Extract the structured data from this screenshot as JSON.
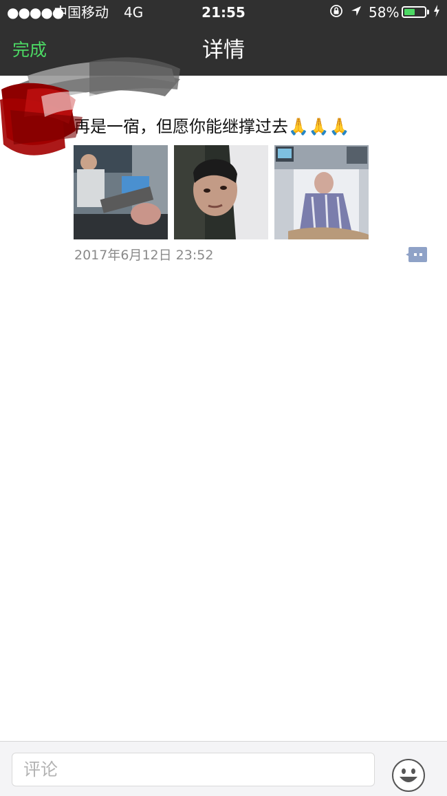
{
  "status_bar": {
    "signal": "●●●●●",
    "carrier": "中国移动",
    "network": "4G",
    "time": "21:55",
    "battery": "58%",
    "battery_level": 0.58,
    "battery_color": "#4cd964"
  },
  "nav": {
    "done_label": "完成",
    "title": "详情"
  },
  "post": {
    "text": "再是一宿，但愿你能继撑过去🙏🙏🙏",
    "photos": [
      "photo-1",
      "photo-2",
      "photo-3"
    ],
    "time": "2017年6月12日 23:52"
  },
  "comment_bar": {
    "placeholder": "评论"
  },
  "icons": {
    "lock": "orientation-lock-icon",
    "location": "location-arrow-icon",
    "charge": "charging-bolt-icon",
    "comment": "comment-bubble-icon",
    "emoji": "smiley-face-icon"
  },
  "colors": {
    "accent_green": "#4cd964",
    "nav_bg": "#303030",
    "comment_icon": "#8fa2c7"
  }
}
